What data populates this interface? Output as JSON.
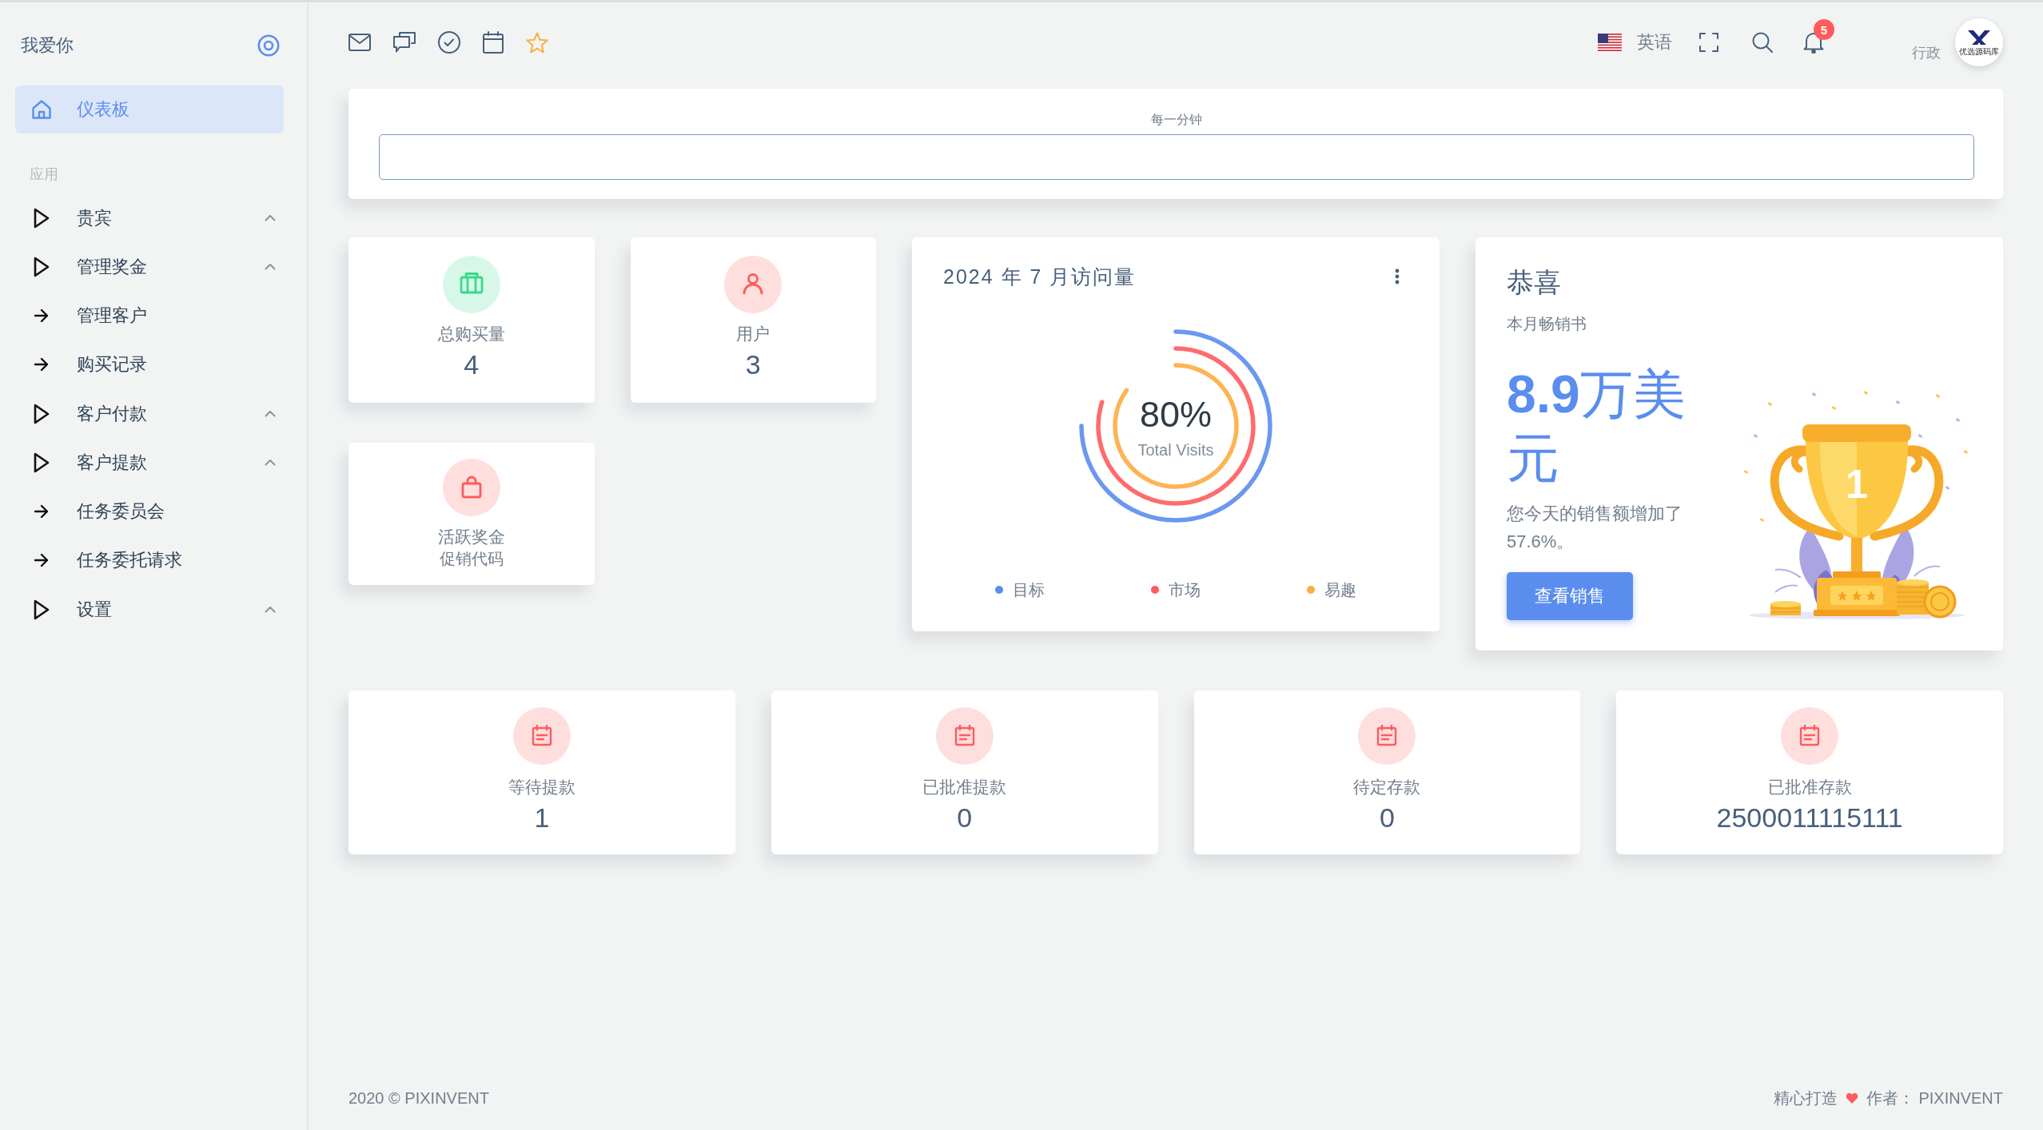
{
  "sidebar": {
    "brand": "我爱你",
    "dashboard": {
      "label": "仪表板",
      "selected": true
    },
    "section": "应用",
    "menu": [
      {
        "label": "贵宾",
        "kind": "group",
        "selected": false
      },
      {
        "label": "管理奖金",
        "kind": "group",
        "selected": false
      },
      {
        "label": "管理客户",
        "kind": "link",
        "selected": false
      },
      {
        "label": "购买记录",
        "kind": "link",
        "selected": false
      },
      {
        "label": "客户付款",
        "kind": "group",
        "selected": false
      },
      {
        "label": "客户提款",
        "kind": "group",
        "selected": false
      },
      {
        "label": "任务委员会",
        "kind": "link",
        "selected": false
      },
      {
        "label": "任务委托请求",
        "kind": "link",
        "selected": false
      },
      {
        "label": "设置",
        "kind": "group",
        "selected": false
      }
    ]
  },
  "navbar": {
    "language": "英语",
    "notifications": "5",
    "role": "行政",
    "logo_text": "优选源码库"
  },
  "timer_card": {
    "label": "每一分钟"
  },
  "stats": [
    {
      "kind": "purchases",
      "label": "总购买量",
      "value": "4",
      "color": "#39da8a"
    },
    {
      "kind": "users",
      "label": "用户",
      "value": "3",
      "color": "#ff5b5c"
    },
    {
      "kind": "promo",
      "label": "活跃奖金",
      "note": "促销代码",
      "color": "#ff5b5c"
    }
  ],
  "visits_card": {
    "title": "2024 年 7 月访问量",
    "center_value": "80%",
    "center_label": "Total Visits",
    "legend": [
      {
        "label": "目标",
        "color": "#5a8dee"
      },
      {
        "label": "市场",
        "color": "#ff5b5c"
      },
      {
        "label": "易趣",
        "color": "#fdac41"
      }
    ]
  },
  "congrats_card": {
    "title": "恭喜",
    "subtitle": "本月畅销书",
    "amount": "**8.9**万美元",
    "note": "您今天的销售额增加了57.6%。",
    "button": "查看销售",
    "trophy_label": "1"
  },
  "transactions": [
    {
      "label": "等待提款",
      "value": "1"
    },
    {
      "label": "已批准提款",
      "value": "0"
    },
    {
      "label": "待定存款",
      "value": "0"
    },
    {
      "label": "已批准存款",
      "value": "2500011115111"
    }
  ],
  "footer": {
    "copyright": "2020 © PIXINVENT",
    "made_with": "精心打造",
    "author": "作者： PIXINVENT"
  }
}
